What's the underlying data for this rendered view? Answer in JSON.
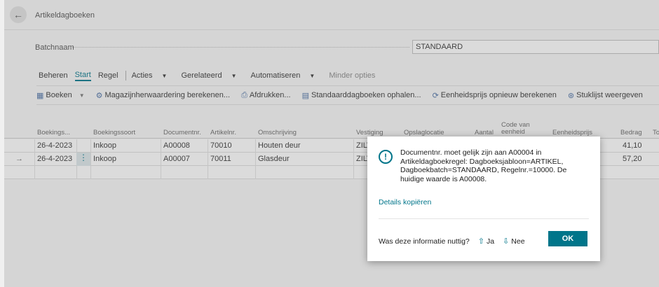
{
  "page": {
    "title": "Artikeldagboeken",
    "back_icon": "←"
  },
  "batch": {
    "label": "Batchnaam",
    "value": "STANDAARD"
  },
  "menu": {
    "beheren": "Beheren",
    "start": "Start",
    "regel": "Regel",
    "acties": "Acties",
    "gerelateerd": "Gerelateerd",
    "automatiseren": "Automatiseren",
    "minder_opties": "Minder opties"
  },
  "actions": {
    "boeken": "Boeken",
    "magazijn": "Magazijnherwaardering berekenen...",
    "afdrukken": "Afdrukken...",
    "standaard": "Standaarddagboeken ophalen...",
    "eenheidsprijs": "Eenheidsprijs opnieuw berekenen",
    "stuklijst": "Stuklijst weergeven"
  },
  "columns": {
    "boekingsdatum": "Boekings...",
    "boekingssoort": "Boekingssoort",
    "documentnr": "Documentnr.",
    "artikelnr": "Artikelnr.",
    "omschrijving": "Omschrijving",
    "vestiging": "Vestiging",
    "opslaglocatie": "Opslaglocatie",
    "aantal": "Aantal",
    "code_eenheid": "Code van eenheid",
    "eenheidsprijs": "Eenheidsprijs",
    "bedrag": "Bedrag",
    "tot": "To"
  },
  "rows": [
    {
      "date": "26-4-2023",
      "type": "Inkoop",
      "doc": "A00008",
      "item": "70010",
      "desc": "Houten deur",
      "loc": "ZILV",
      "amount": "41,10"
    },
    {
      "date": "26-4-2023",
      "type": "Inkoop",
      "doc": "A00007",
      "item": "70011",
      "desc": "Glasdeur",
      "loc": "ZILV",
      "amount": "57,20"
    }
  ],
  "dialog": {
    "message": "Documentnr. moet gelijk zijn aan A00004 in Artikeldagboekregel: Dagboeksjabloon=ARTIKEL, Dagboekbatch=STANDAARD, Regelnr.=10000. De huidige waarde is A00008.",
    "copy_details": "Details kopiëren",
    "feedback_question": "Was deze informatie nuttig?",
    "yes": "Ja",
    "no": "Nee",
    "ok": "OK"
  },
  "colors": {
    "accent": "#00758a"
  }
}
